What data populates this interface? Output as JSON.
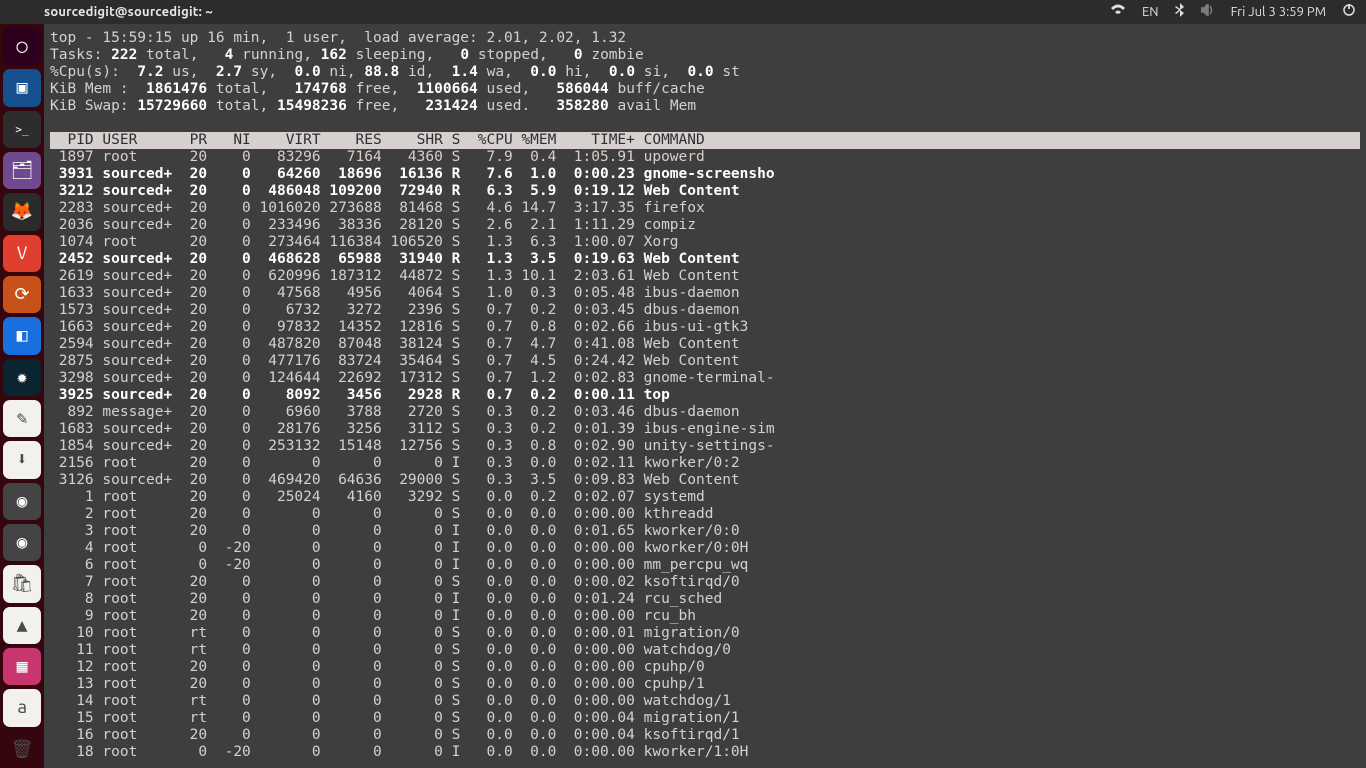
{
  "topbar": {
    "title": "sourcedigit@sourcedigit: ~",
    "lang": "EN",
    "datetime": "Fri Jul 3  3:59 PM"
  },
  "top_header": {
    "line1_pre": "top - 15:59:15 up 16 min,  1 user,  load average: 2.01, 2.02, 1.32",
    "tasks": {
      "label": "Tasks:",
      "total": "222",
      "running": "4",
      "sleeping": "162",
      "stopped": "0",
      "zombie": "0"
    },
    "cpu": {
      "label": "%Cpu(s):",
      "us": "7.2",
      "sy": "2.7",
      "ni": "0.0",
      "id": "88.8",
      "wa": "1.4",
      "hi": "0.0",
      "si": "0.0",
      "st": "0.0"
    },
    "mem": {
      "label": "KiB Mem :",
      "total": "1861476",
      "free": "174768",
      "used": "1100664",
      "buff": "586044"
    },
    "swap": {
      "label": "KiB Swap:",
      "total": "15729660",
      "free": "15498236",
      "used": "231424",
      "avail": "358280"
    }
  },
  "columns": [
    "PID",
    "USER",
    "PR",
    "NI",
    "VIRT",
    "RES",
    "SHR",
    "S",
    "%CPU",
    "%MEM",
    "TIME+",
    "COMMAND"
  ],
  "processes": [
    {
      "pid": "1897",
      "user": "root",
      "pr": "20",
      "ni": "0",
      "virt": "83296",
      "res": "7164",
      "shr": "4360",
      "s": "S",
      "cpu": "7.9",
      "mem": "0.4",
      "time": "1:05.91",
      "cmd": "upowerd",
      "bold": false
    },
    {
      "pid": "3931",
      "user": "sourced+",
      "pr": "20",
      "ni": "0",
      "virt": "64260",
      "res": "18696",
      "shr": "16136",
      "s": "R",
      "cpu": "7.6",
      "mem": "1.0",
      "time": "0:00.23",
      "cmd": "gnome-screensho",
      "bold": true
    },
    {
      "pid": "3212",
      "user": "sourced+",
      "pr": "20",
      "ni": "0",
      "virt": "486048",
      "res": "109200",
      "shr": "72940",
      "s": "R",
      "cpu": "6.3",
      "mem": "5.9",
      "time": "0:19.12",
      "cmd": "Web Content",
      "bold": true
    },
    {
      "pid": "2283",
      "user": "sourced+",
      "pr": "20",
      "ni": "0",
      "virt": "1016020",
      "res": "273688",
      "shr": "81468",
      "s": "S",
      "cpu": "4.6",
      "mem": "14.7",
      "time": "3:17.35",
      "cmd": "firefox",
      "bold": false
    },
    {
      "pid": "2036",
      "user": "sourced+",
      "pr": "20",
      "ni": "0",
      "virt": "233496",
      "res": "38336",
      "shr": "28120",
      "s": "S",
      "cpu": "2.6",
      "mem": "2.1",
      "time": "1:11.29",
      "cmd": "compiz",
      "bold": false
    },
    {
      "pid": "1074",
      "user": "root",
      "pr": "20",
      "ni": "0",
      "virt": "273464",
      "res": "116384",
      "shr": "106520",
      "s": "S",
      "cpu": "1.3",
      "mem": "6.3",
      "time": "1:00.07",
      "cmd": "Xorg",
      "bold": false
    },
    {
      "pid": "2452",
      "user": "sourced+",
      "pr": "20",
      "ni": "0",
      "virt": "468628",
      "res": "65988",
      "shr": "31940",
      "s": "R",
      "cpu": "1.3",
      "mem": "3.5",
      "time": "0:19.63",
      "cmd": "Web Content",
      "bold": true
    },
    {
      "pid": "2619",
      "user": "sourced+",
      "pr": "20",
      "ni": "0",
      "virt": "620996",
      "res": "187312",
      "shr": "44872",
      "s": "S",
      "cpu": "1.3",
      "mem": "10.1",
      "time": "2:03.61",
      "cmd": "Web Content",
      "bold": false
    },
    {
      "pid": "1633",
      "user": "sourced+",
      "pr": "20",
      "ni": "0",
      "virt": "47568",
      "res": "4956",
      "shr": "4064",
      "s": "S",
      "cpu": "1.0",
      "mem": "0.3",
      "time": "0:05.48",
      "cmd": "ibus-daemon",
      "bold": false
    },
    {
      "pid": "1573",
      "user": "sourced+",
      "pr": "20",
      "ni": "0",
      "virt": "6732",
      "res": "3272",
      "shr": "2396",
      "s": "S",
      "cpu": "0.7",
      "mem": "0.2",
      "time": "0:03.45",
      "cmd": "dbus-daemon",
      "bold": false
    },
    {
      "pid": "1663",
      "user": "sourced+",
      "pr": "20",
      "ni": "0",
      "virt": "97832",
      "res": "14352",
      "shr": "12816",
      "s": "S",
      "cpu": "0.7",
      "mem": "0.8",
      "time": "0:02.66",
      "cmd": "ibus-ui-gtk3",
      "bold": false
    },
    {
      "pid": "2594",
      "user": "sourced+",
      "pr": "20",
      "ni": "0",
      "virt": "487820",
      "res": "87048",
      "shr": "38124",
      "s": "S",
      "cpu": "0.7",
      "mem": "4.7",
      "time": "0:41.08",
      "cmd": "Web Content",
      "bold": false
    },
    {
      "pid": "2875",
      "user": "sourced+",
      "pr": "20",
      "ni": "0",
      "virt": "477176",
      "res": "83724",
      "shr": "35464",
      "s": "S",
      "cpu": "0.7",
      "mem": "4.5",
      "time": "0:24.42",
      "cmd": "Web Content",
      "bold": false
    },
    {
      "pid": "3298",
      "user": "sourced+",
      "pr": "20",
      "ni": "0",
      "virt": "124644",
      "res": "22692",
      "shr": "17312",
      "s": "S",
      "cpu": "0.7",
      "mem": "1.2",
      "time": "0:02.83",
      "cmd": "gnome-terminal-",
      "bold": false
    },
    {
      "pid": "3925",
      "user": "sourced+",
      "pr": "20",
      "ni": "0",
      "virt": "8092",
      "res": "3456",
      "shr": "2928",
      "s": "R",
      "cpu": "0.7",
      "mem": "0.2",
      "time": "0:00.11",
      "cmd": "top",
      "bold": true
    },
    {
      "pid": "892",
      "user": "message+",
      "pr": "20",
      "ni": "0",
      "virt": "6960",
      "res": "3788",
      "shr": "2720",
      "s": "S",
      "cpu": "0.3",
      "mem": "0.2",
      "time": "0:03.46",
      "cmd": "dbus-daemon",
      "bold": false
    },
    {
      "pid": "1683",
      "user": "sourced+",
      "pr": "20",
      "ni": "0",
      "virt": "28176",
      "res": "3256",
      "shr": "3112",
      "s": "S",
      "cpu": "0.3",
      "mem": "0.2",
      "time": "0:01.39",
      "cmd": "ibus-engine-sim",
      "bold": false
    },
    {
      "pid": "1854",
      "user": "sourced+",
      "pr": "20",
      "ni": "0",
      "virt": "253132",
      "res": "15148",
      "shr": "12756",
      "s": "S",
      "cpu": "0.3",
      "mem": "0.8",
      "time": "0:02.90",
      "cmd": "unity-settings-",
      "bold": false
    },
    {
      "pid": "2156",
      "user": "root",
      "pr": "20",
      "ni": "0",
      "virt": "0",
      "res": "0",
      "shr": "0",
      "s": "I",
      "cpu": "0.3",
      "mem": "0.0",
      "time": "0:02.11",
      "cmd": "kworker/0:2",
      "bold": false
    },
    {
      "pid": "3126",
      "user": "sourced+",
      "pr": "20",
      "ni": "0",
      "virt": "469420",
      "res": "64636",
      "shr": "29000",
      "s": "S",
      "cpu": "0.3",
      "mem": "3.5",
      "time": "0:09.83",
      "cmd": "Web Content",
      "bold": false
    },
    {
      "pid": "1",
      "user": "root",
      "pr": "20",
      "ni": "0",
      "virt": "25024",
      "res": "4160",
      "shr": "3292",
      "s": "S",
      "cpu": "0.0",
      "mem": "0.2",
      "time": "0:02.07",
      "cmd": "systemd",
      "bold": false
    },
    {
      "pid": "2",
      "user": "root",
      "pr": "20",
      "ni": "0",
      "virt": "0",
      "res": "0",
      "shr": "0",
      "s": "S",
      "cpu": "0.0",
      "mem": "0.0",
      "time": "0:00.00",
      "cmd": "kthreadd",
      "bold": false
    },
    {
      "pid": "3",
      "user": "root",
      "pr": "20",
      "ni": "0",
      "virt": "0",
      "res": "0",
      "shr": "0",
      "s": "I",
      "cpu": "0.0",
      "mem": "0.0",
      "time": "0:01.65",
      "cmd": "kworker/0:0",
      "bold": false
    },
    {
      "pid": "4",
      "user": "root",
      "pr": "0",
      "ni": "-20",
      "virt": "0",
      "res": "0",
      "shr": "0",
      "s": "I",
      "cpu": "0.0",
      "mem": "0.0",
      "time": "0:00.00",
      "cmd": "kworker/0:0H",
      "bold": false
    },
    {
      "pid": "6",
      "user": "root",
      "pr": "0",
      "ni": "-20",
      "virt": "0",
      "res": "0",
      "shr": "0",
      "s": "I",
      "cpu": "0.0",
      "mem": "0.0",
      "time": "0:00.00",
      "cmd": "mm_percpu_wq",
      "bold": false
    },
    {
      "pid": "7",
      "user": "root",
      "pr": "20",
      "ni": "0",
      "virt": "0",
      "res": "0",
      "shr": "0",
      "s": "S",
      "cpu": "0.0",
      "mem": "0.0",
      "time": "0:00.02",
      "cmd": "ksoftirqd/0",
      "bold": false
    },
    {
      "pid": "8",
      "user": "root",
      "pr": "20",
      "ni": "0",
      "virt": "0",
      "res": "0",
      "shr": "0",
      "s": "I",
      "cpu": "0.0",
      "mem": "0.0",
      "time": "0:01.24",
      "cmd": "rcu_sched",
      "bold": false
    },
    {
      "pid": "9",
      "user": "root",
      "pr": "20",
      "ni": "0",
      "virt": "0",
      "res": "0",
      "shr": "0",
      "s": "I",
      "cpu": "0.0",
      "mem": "0.0",
      "time": "0:00.00",
      "cmd": "rcu_bh",
      "bold": false
    },
    {
      "pid": "10",
      "user": "root",
      "pr": "rt",
      "ni": "0",
      "virt": "0",
      "res": "0",
      "shr": "0",
      "s": "S",
      "cpu": "0.0",
      "mem": "0.0",
      "time": "0:00.01",
      "cmd": "migration/0",
      "bold": false
    },
    {
      "pid": "11",
      "user": "root",
      "pr": "rt",
      "ni": "0",
      "virt": "0",
      "res": "0",
      "shr": "0",
      "s": "S",
      "cpu": "0.0",
      "mem": "0.0",
      "time": "0:00.00",
      "cmd": "watchdog/0",
      "bold": false
    },
    {
      "pid": "12",
      "user": "root",
      "pr": "20",
      "ni": "0",
      "virt": "0",
      "res": "0",
      "shr": "0",
      "s": "S",
      "cpu": "0.0",
      "mem": "0.0",
      "time": "0:00.00",
      "cmd": "cpuhp/0",
      "bold": false
    },
    {
      "pid": "13",
      "user": "root",
      "pr": "20",
      "ni": "0",
      "virt": "0",
      "res": "0",
      "shr": "0",
      "s": "S",
      "cpu": "0.0",
      "mem": "0.0",
      "time": "0:00.00",
      "cmd": "cpuhp/1",
      "bold": false
    },
    {
      "pid": "14",
      "user": "root",
      "pr": "rt",
      "ni": "0",
      "virt": "0",
      "res": "0",
      "shr": "0",
      "s": "S",
      "cpu": "0.0",
      "mem": "0.0",
      "time": "0:00.00",
      "cmd": "watchdog/1",
      "bold": false
    },
    {
      "pid": "15",
      "user": "root",
      "pr": "rt",
      "ni": "0",
      "virt": "0",
      "res": "0",
      "shr": "0",
      "s": "S",
      "cpu": "0.0",
      "mem": "0.0",
      "time": "0:00.04",
      "cmd": "migration/1",
      "bold": false
    },
    {
      "pid": "16",
      "user": "root",
      "pr": "20",
      "ni": "0",
      "virt": "0",
      "res": "0",
      "shr": "0",
      "s": "S",
      "cpu": "0.0",
      "mem": "0.0",
      "time": "0:00.04",
      "cmd": "ksoftirqd/1",
      "bold": false
    },
    {
      "pid": "18",
      "user": "root",
      "pr": "0",
      "ni": "-20",
      "virt": "0",
      "res": "0",
      "shr": "0",
      "s": "I",
      "cpu": "0.0",
      "mem": "0.0",
      "time": "0:00.00",
      "cmd": "kworker/1:0H",
      "bold": false
    }
  ],
  "launcher_icons": [
    {
      "name": "ubuntu-dash-icon",
      "bg": "#2c001e",
      "glyph": "◯"
    },
    {
      "name": "folder-icon",
      "bg": "#17508e",
      "glyph": "▣"
    },
    {
      "name": "terminal-icon",
      "bg": "#2d2d2d",
      "glyph": ">_"
    },
    {
      "name": "files-icon",
      "bg": "#6f4a8e",
      "glyph": "🗂"
    },
    {
      "name": "firefox-icon",
      "bg": "#2b2b2b",
      "glyph": "🦊"
    },
    {
      "name": "brave-icon",
      "bg": "#e03e2f",
      "glyph": "V"
    },
    {
      "name": "sync-icon",
      "bg": "#c75219",
      "glyph": "⟳"
    },
    {
      "name": "app-icon",
      "bg": "#1a6fde",
      "glyph": "◧"
    },
    {
      "name": "settings-icon",
      "bg": "#0b2530",
      "glyph": "✹"
    },
    {
      "name": "document-icon",
      "bg": "#f3f1ee",
      "glyph": "✎"
    },
    {
      "name": "download-icon",
      "bg": "#f3f1ee",
      "glyph": "⬇"
    },
    {
      "name": "disk1-icon",
      "bg": "#444",
      "glyph": "◉"
    },
    {
      "name": "disk2-icon",
      "bg": "#444",
      "glyph": "◉"
    },
    {
      "name": "software-icon",
      "bg": "#f3f1ee",
      "glyph": "🛍"
    },
    {
      "name": "vlc-icon",
      "bg": "#f3f1ee",
      "glyph": "▲"
    },
    {
      "name": "image-icon",
      "bg": "#c7366f",
      "glyph": "▦"
    },
    {
      "name": "amazon-icon",
      "bg": "#f3f1ee",
      "glyph": "a"
    },
    {
      "name": "trash-icon",
      "bg": "transparent",
      "glyph": "🗑"
    }
  ]
}
